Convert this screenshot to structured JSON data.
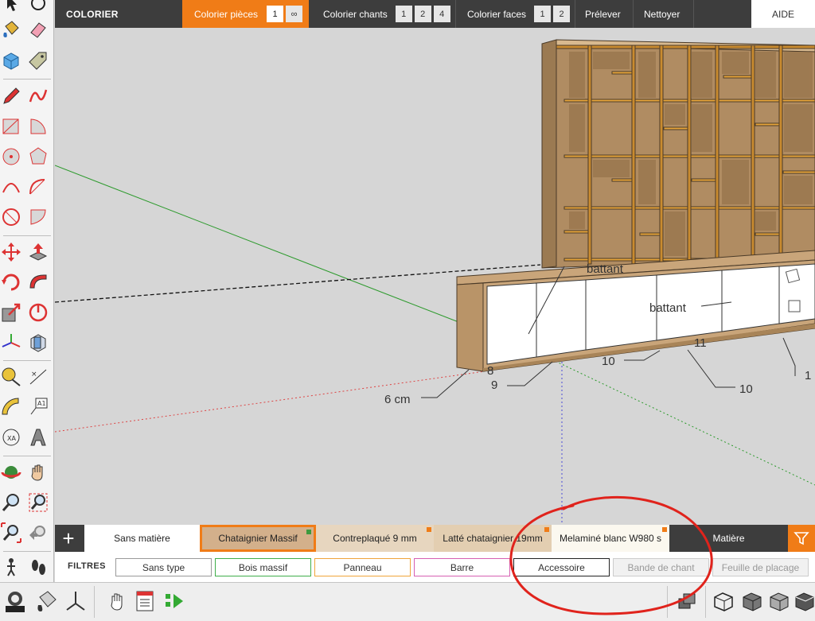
{
  "topbar": {
    "title": "COLORIER",
    "colorier_pieces": {
      "label": "Colorier pièces",
      "options": [
        "1",
        "∞"
      ],
      "active_option": "1"
    },
    "colorier_chants": {
      "label": "Colorier chants",
      "options": [
        "1",
        "2",
        "4"
      ]
    },
    "colorier_faces": {
      "label": "Colorier faces",
      "options": [
        "1",
        "2"
      ]
    },
    "prelever": "Prélever",
    "nettoyer": "Nettoyer",
    "aide": "AIDE"
  },
  "viewport": {
    "labels": {
      "battant_top": "battant",
      "battant_mid": "battant",
      "dim_6cm": "6 cm",
      "dim_9": "9",
      "dim_8": "8",
      "dim_10a": "10",
      "dim_10b": "10",
      "dim_11": "11",
      "dim_1": "1"
    }
  },
  "materials": {
    "tabs": [
      {
        "label": "Sans matière",
        "bg": "#ffffff",
        "dot": false,
        "selected": false
      },
      {
        "label": "Chataignier Massif",
        "bg": "#d3b08b",
        "dot": true,
        "selected": true
      },
      {
        "label": "Contreplaqué 9 mm",
        "bg": "#e7d6bf",
        "dot": true,
        "selected": false
      },
      {
        "label": "Latté chataignier 19mm",
        "bg": "#e3ceb1",
        "dot": true,
        "selected": false
      },
      {
        "label": "Melaminé blanc W980 s",
        "bg": "#fbf8ef",
        "dot": true,
        "selected": false
      }
    ],
    "matiere_label": "Matière"
  },
  "filters": {
    "label": "FILTRES",
    "chips": [
      {
        "label": "Sans type",
        "color": "#9a9a9a",
        "disabled": false
      },
      {
        "label": "Bois massif",
        "color": "#3fae4a",
        "disabled": false
      },
      {
        "label": "Panneau",
        "color": "#f0a43a",
        "disabled": false
      },
      {
        "label": "Barre",
        "color": "#d65fb2",
        "disabled": false
      },
      {
        "label": "Accessoire",
        "color": "#222222",
        "disabled": false
      },
      {
        "label": "Bande de chant",
        "color": "#cccccc",
        "disabled": true
      },
      {
        "label": "Feuille de placage",
        "color": "#cccccc",
        "disabled": true
      }
    ]
  },
  "colors": {
    "accent_orange": "#f07c17",
    "dark_bar": "#3d3d3d",
    "annotation_red": "#e0231c",
    "wood": "#c9a57a",
    "door_white": "#ffffff"
  }
}
